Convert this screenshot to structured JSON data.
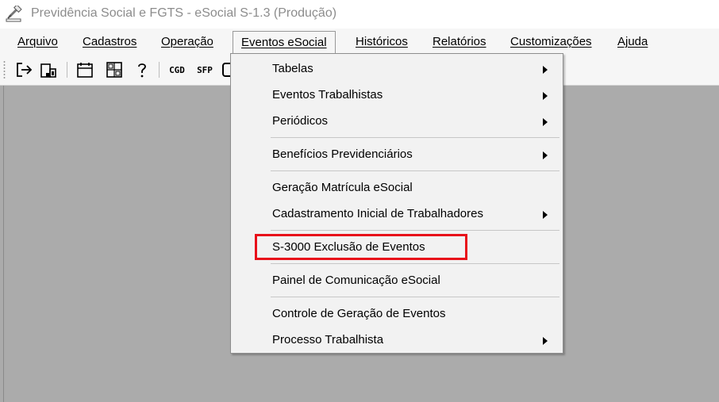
{
  "window": {
    "title": "Previdência Social e FGTS - eSocial S-1.3 (Produção)",
    "icon": "gavel-icon"
  },
  "menubar": {
    "items": [
      {
        "label": "Arquivo"
      },
      {
        "label": "Cadastros"
      },
      {
        "label": "Operação"
      },
      {
        "label": "Eventos eSocial",
        "open": true
      },
      {
        "label": "Históricos"
      },
      {
        "label": "Relatórios"
      },
      {
        "label": "Customizações"
      },
      {
        "label": "Ajuda"
      }
    ]
  },
  "toolbar": {
    "buttons": [
      {
        "icon": "exit-icon"
      },
      {
        "icon": "company-icon"
      },
      {
        "icon": "calendar-icon"
      },
      {
        "icon": "calculator-icon"
      },
      {
        "icon": "help-icon"
      },
      {
        "label": "CGD"
      },
      {
        "label": "SFP"
      }
    ]
  },
  "dropdown": {
    "items": [
      {
        "label": "Tabelas",
        "submenu": true
      },
      {
        "label": "Eventos Trabalhistas",
        "submenu": true
      },
      {
        "label": "Periódicos",
        "submenu": true
      },
      {
        "label": "Benefícios Previdenciários",
        "submenu": true
      },
      {
        "label": "Geração Matrícula eSocial",
        "submenu": false
      },
      {
        "label": "Cadastramento Inicial de Trabalhadores",
        "submenu": true
      },
      {
        "label": "S-3000 Exclusão de Eventos",
        "submenu": false,
        "highlighted": true
      },
      {
        "label": "Painel de Comunicação eSocial",
        "submenu": false
      },
      {
        "label": "Controle de Geração de Eventos",
        "submenu": false
      },
      {
        "label": "Processo Trabalhista",
        "submenu": true
      }
    ]
  },
  "colors": {
    "highlight_border": "#e8101a",
    "workspace": "#ababab",
    "title_text": "#8c8c8c"
  }
}
